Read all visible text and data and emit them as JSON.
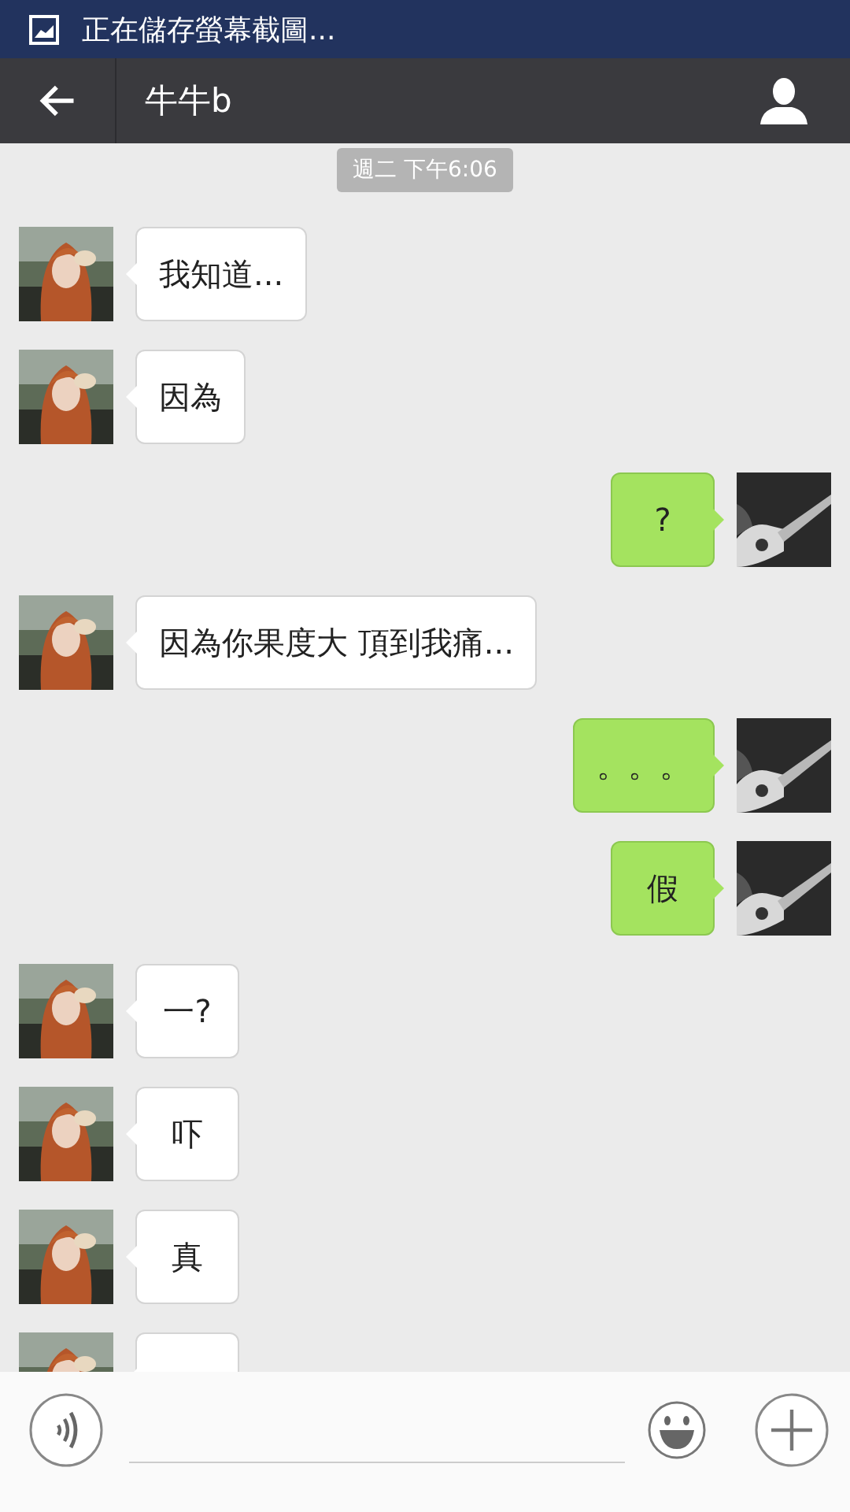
{
  "status_bar": {
    "notification": "正在儲存螢幕截圖..."
  },
  "header": {
    "title": "牛牛b"
  },
  "timestamp": "週二 下午6:06",
  "messages": [
    {
      "kind": "received",
      "text": "我知道..."
    },
    {
      "kind": "received",
      "text": "因為"
    },
    {
      "kind": "sent",
      "text": "?"
    },
    {
      "kind": "received",
      "text": "因為你果度大 頂到我痛..."
    },
    {
      "kind": "sent",
      "text": "。。。"
    },
    {
      "kind": "sent",
      "text": "假"
    },
    {
      "kind": "received",
      "text": "一?"
    },
    {
      "kind": "received",
      "text": "吓"
    },
    {
      "kind": "received",
      "text": "真"
    },
    {
      "kind": "received"
    }
  ]
}
